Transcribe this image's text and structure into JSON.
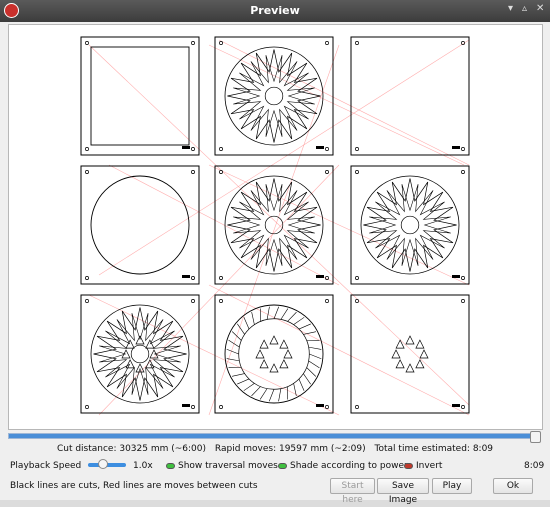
{
  "window": {
    "title": "Preview"
  },
  "titlebar_icons": [
    "app-icon",
    "minimize-icon",
    "maximize-icon",
    "close-icon"
  ],
  "canvas": {
    "legend_cuts_color": "#000000",
    "moves_color": "#ff8c8c",
    "tiles": [
      {
        "shape": "square",
        "ring_dots": 0,
        "triangles": 0
      },
      {
        "shape": "starburst",
        "ring_dots": 0,
        "triangles": 8
      },
      {
        "shape": "empty",
        "ring_dots": 0,
        "triangles": 0
      },
      {
        "shape": "circle",
        "ring_dots": 0,
        "triangles": 0
      },
      {
        "shape": "starburst",
        "ring_dots": 0,
        "triangles": 8
      },
      {
        "shape": "starburst",
        "ring_dots": 0,
        "triangles": 8
      },
      {
        "shape": "starburst-outer",
        "ring_dots": 0,
        "triangles": 8
      },
      {
        "shape": "ring",
        "ring_dots": 0,
        "triangles": 8
      },
      {
        "shape": "triangles-only",
        "ring_dots": 0,
        "triangles": 8
      }
    ]
  },
  "progress": {
    "fraction": 1.0
  },
  "stats": {
    "cut_distance": "Cut distance: 30325 mm (~6:00)",
    "rapid_moves": "Rapid moves: 19597 mm (~2:09)",
    "total_time": "Total time estimated: 8:09"
  },
  "controls": {
    "playback_label": "Playback Speed",
    "speed_fraction": 0.4,
    "speed_value": "1.0x",
    "show_traversal": "Show traversal moves",
    "show_traversal_on": true,
    "shade_power": "Shade according to power",
    "shade_power_on": true,
    "invert": "Invert",
    "invert_on": false,
    "elapsed": "8:09"
  },
  "status": {
    "message": "Black lines are cuts, Red lines are moves between cuts"
  },
  "buttons": {
    "start_here": "Start here",
    "save_image": "Save Image",
    "play": "Play",
    "ok": "Ok"
  }
}
